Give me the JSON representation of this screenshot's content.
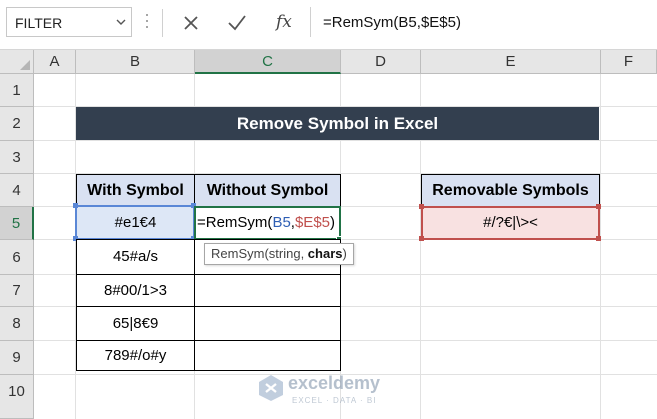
{
  "name_box": {
    "value": "FILTER"
  },
  "formula_bar": {
    "fx_label": "fx",
    "formula": "=RemSym(B5,$E$5)"
  },
  "columns": [
    "A",
    "B",
    "C",
    "D",
    "E",
    "F"
  ],
  "rows": [
    "1",
    "2",
    "3",
    "4",
    "5",
    "6",
    "7",
    "8",
    "9",
    "10"
  ],
  "selected_column": "C",
  "selected_row": "5",
  "banner": {
    "title": "Remove Symbol in Excel"
  },
  "table": {
    "headers": [
      "With Symbol",
      "Without Symbol"
    ],
    "with_symbol": [
      "#e1€4",
      "45#a/s",
      "8#00/1>3",
      "65|8€9",
      "789#/o#y"
    ],
    "active_cell_formula": {
      "prefix": "=RemSym(",
      "arg1": "B5",
      "sep": ",",
      "arg2": "$E$5",
      "suffix": ")"
    }
  },
  "removable": {
    "header": "Removable Symbols",
    "value": "#/?€|\\><"
  },
  "tooltip": {
    "prefix": "RemSym(string, ",
    "bold": "chars",
    "suffix": ")"
  },
  "watermark": {
    "name": "exceldemy",
    "tagline": "EXCEL · DATA · BI"
  },
  "colors": {
    "banner_bg": "#333f4f",
    "header_bg": "#d9e1f2",
    "excel_green": "#217346",
    "ref_blue": "#2f5fb4",
    "ref_red": "#c0504d"
  }
}
